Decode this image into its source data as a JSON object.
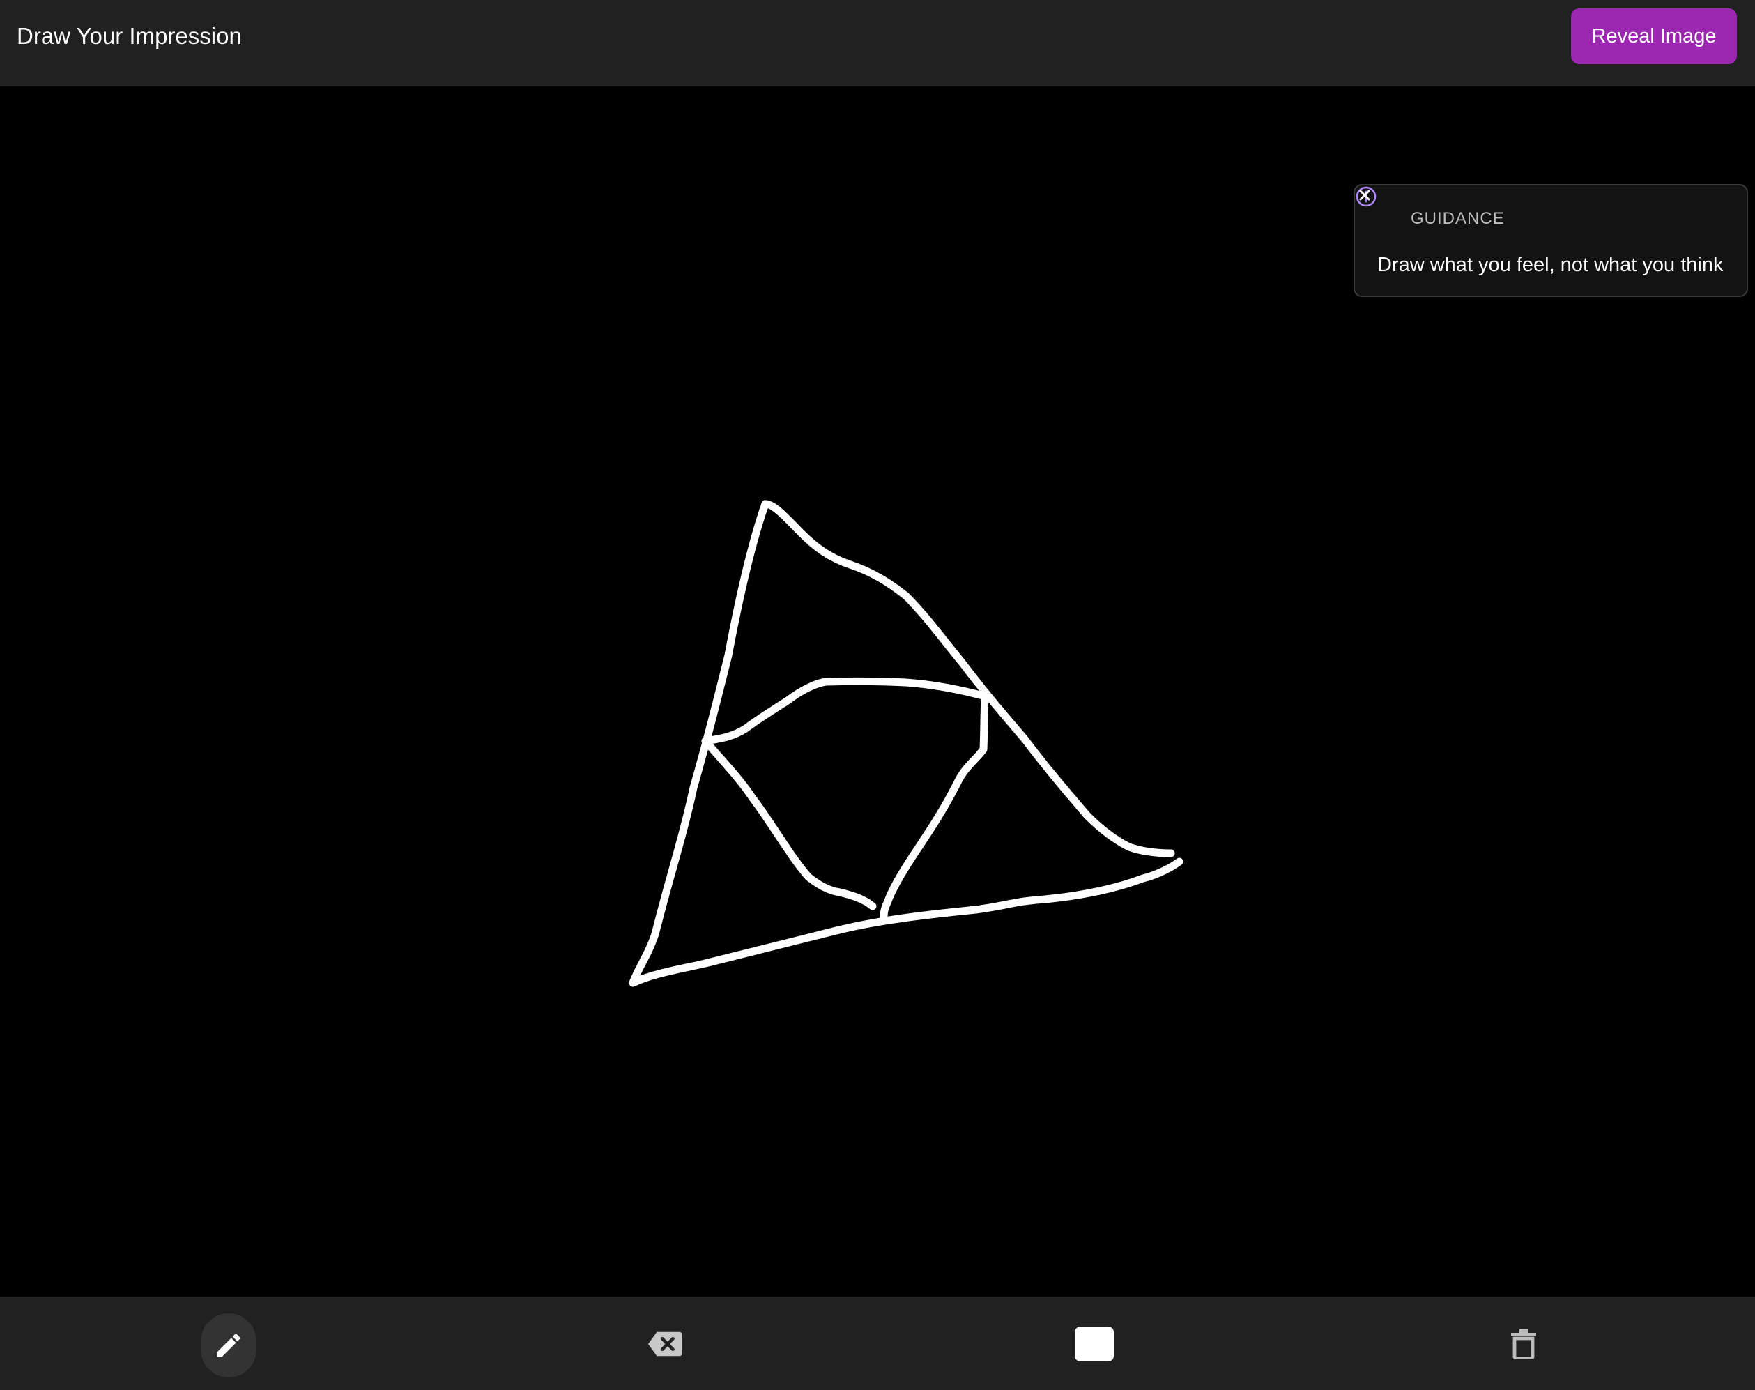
{
  "header": {
    "title": "Draw Your Impression",
    "reveal_label": "Reveal Image"
  },
  "guidance": {
    "heading": "GUIDANCE",
    "text": "Draw what you feel, not what you think",
    "icon": "info-circle-icon"
  },
  "canvas": {
    "background": "#000000",
    "stroke_color": "#ffffff"
  },
  "toolbar": {
    "tools": [
      {
        "name": "pencil",
        "icon": "pencil-icon",
        "active": true
      },
      {
        "name": "eraser",
        "icon": "backspace-eraser-icon",
        "active": false
      },
      {
        "name": "color",
        "icon": "color-swatch",
        "active": false
      },
      {
        "name": "clear",
        "icon": "trash-icon",
        "active": false
      }
    ],
    "selected_color": "#ffffff"
  },
  "colors": {
    "accent": "#9c27b0",
    "bar_background": "#212121",
    "guidance_icon": "#b388ff"
  }
}
